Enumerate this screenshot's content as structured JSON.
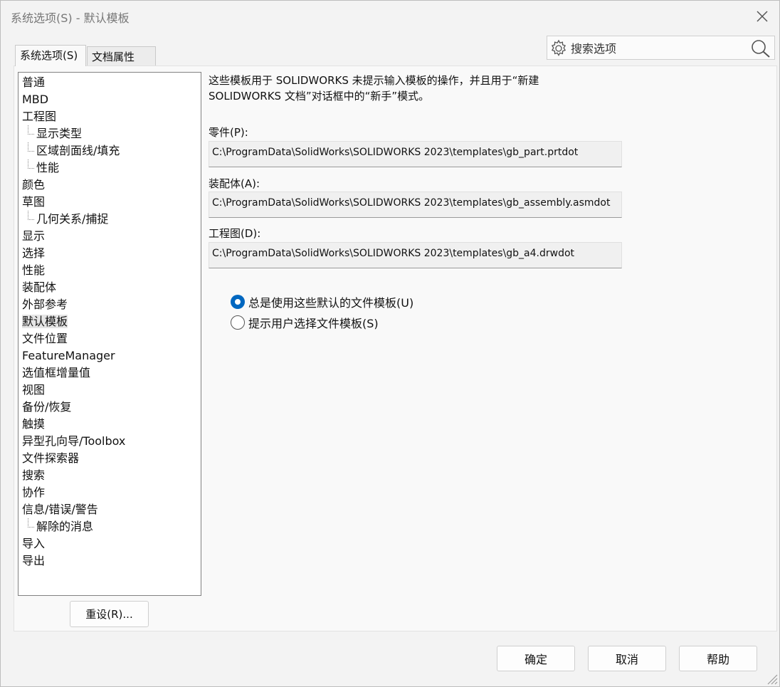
{
  "window": {
    "title": "系统选项(S) - 默认模板",
    "close_glyph": "✕"
  },
  "search": {
    "placeholder": "搜索选项"
  },
  "tabs": [
    {
      "label": "系统选项(S)",
      "active": true
    },
    {
      "label": "文档属性(D)",
      "active": false
    }
  ],
  "tree": {
    "items": [
      {
        "label": "普通",
        "level": 0
      },
      {
        "label": "MBD",
        "level": 0
      },
      {
        "label": "工程图",
        "level": 0
      },
      {
        "label": "显示类型",
        "level": 1
      },
      {
        "label": "区域剖面线/填充",
        "level": 1
      },
      {
        "label": "性能",
        "level": 1
      },
      {
        "label": "颜色",
        "level": 0
      },
      {
        "label": "草图",
        "level": 0
      },
      {
        "label": "几何关系/捕捉",
        "level": 1
      },
      {
        "label": "显示",
        "level": 0
      },
      {
        "label": "选择",
        "level": 0
      },
      {
        "label": "性能",
        "level": 0
      },
      {
        "label": "装配体",
        "level": 0
      },
      {
        "label": "外部参考",
        "level": 0
      },
      {
        "label": "默认模板",
        "level": 0,
        "selected": true
      },
      {
        "label": "文件位置",
        "level": 0
      },
      {
        "label": "FeatureManager",
        "level": 0
      },
      {
        "label": "选值框增量值",
        "level": 0
      },
      {
        "label": "视图",
        "level": 0
      },
      {
        "label": "备份/恢复",
        "level": 0
      },
      {
        "label": "触摸",
        "level": 0
      },
      {
        "label": "异型孔向导/Toolbox",
        "level": 0
      },
      {
        "label": "文件探索器",
        "level": 0
      },
      {
        "label": "搜索",
        "level": 0
      },
      {
        "label": "协作",
        "level": 0
      },
      {
        "label": "信息/错误/警告",
        "level": 0
      },
      {
        "label": "解除的消息",
        "level": 1
      },
      {
        "label": "导入",
        "level": 0
      },
      {
        "label": "导出",
        "level": 0
      }
    ],
    "reset_label": "重设(R)..."
  },
  "main": {
    "description_line1": "这些模板用于 SOLIDWORKS 未提示输入模板的操作，并且用于“新建",
    "description_line2": "SOLIDWORKS 文档”对话框中的“新手”模式。",
    "part": {
      "label": "零件(P):",
      "value": "C:\\ProgramData\\SolidWorks\\SOLIDWORKS 2023\\templates\\gb_part.prtdot"
    },
    "assembly": {
      "label": "装配体(A):",
      "value": "C:\\ProgramData\\SolidWorks\\SOLIDWORKS 2023\\templates\\gb_assembly.asmdot"
    },
    "drawing": {
      "label": "工程图(D):",
      "value": "C:\\ProgramData\\SolidWorks\\SOLIDWORKS 2023\\templates\\gb_a4.drwdot"
    },
    "radio_always": {
      "label": "总是使用这些默认的文件模板(U)",
      "checked": true
    },
    "radio_prompt": {
      "label": "提示用户选择文件模板(S)",
      "checked": false
    }
  },
  "footer": {
    "ok_label": "确定",
    "cancel_label": "取消",
    "help_label": "帮助"
  },
  "colors": {
    "accent": "#0067c0",
    "panel_bg": "#f9f9f9",
    "window_bg": "#f3f3f3"
  }
}
